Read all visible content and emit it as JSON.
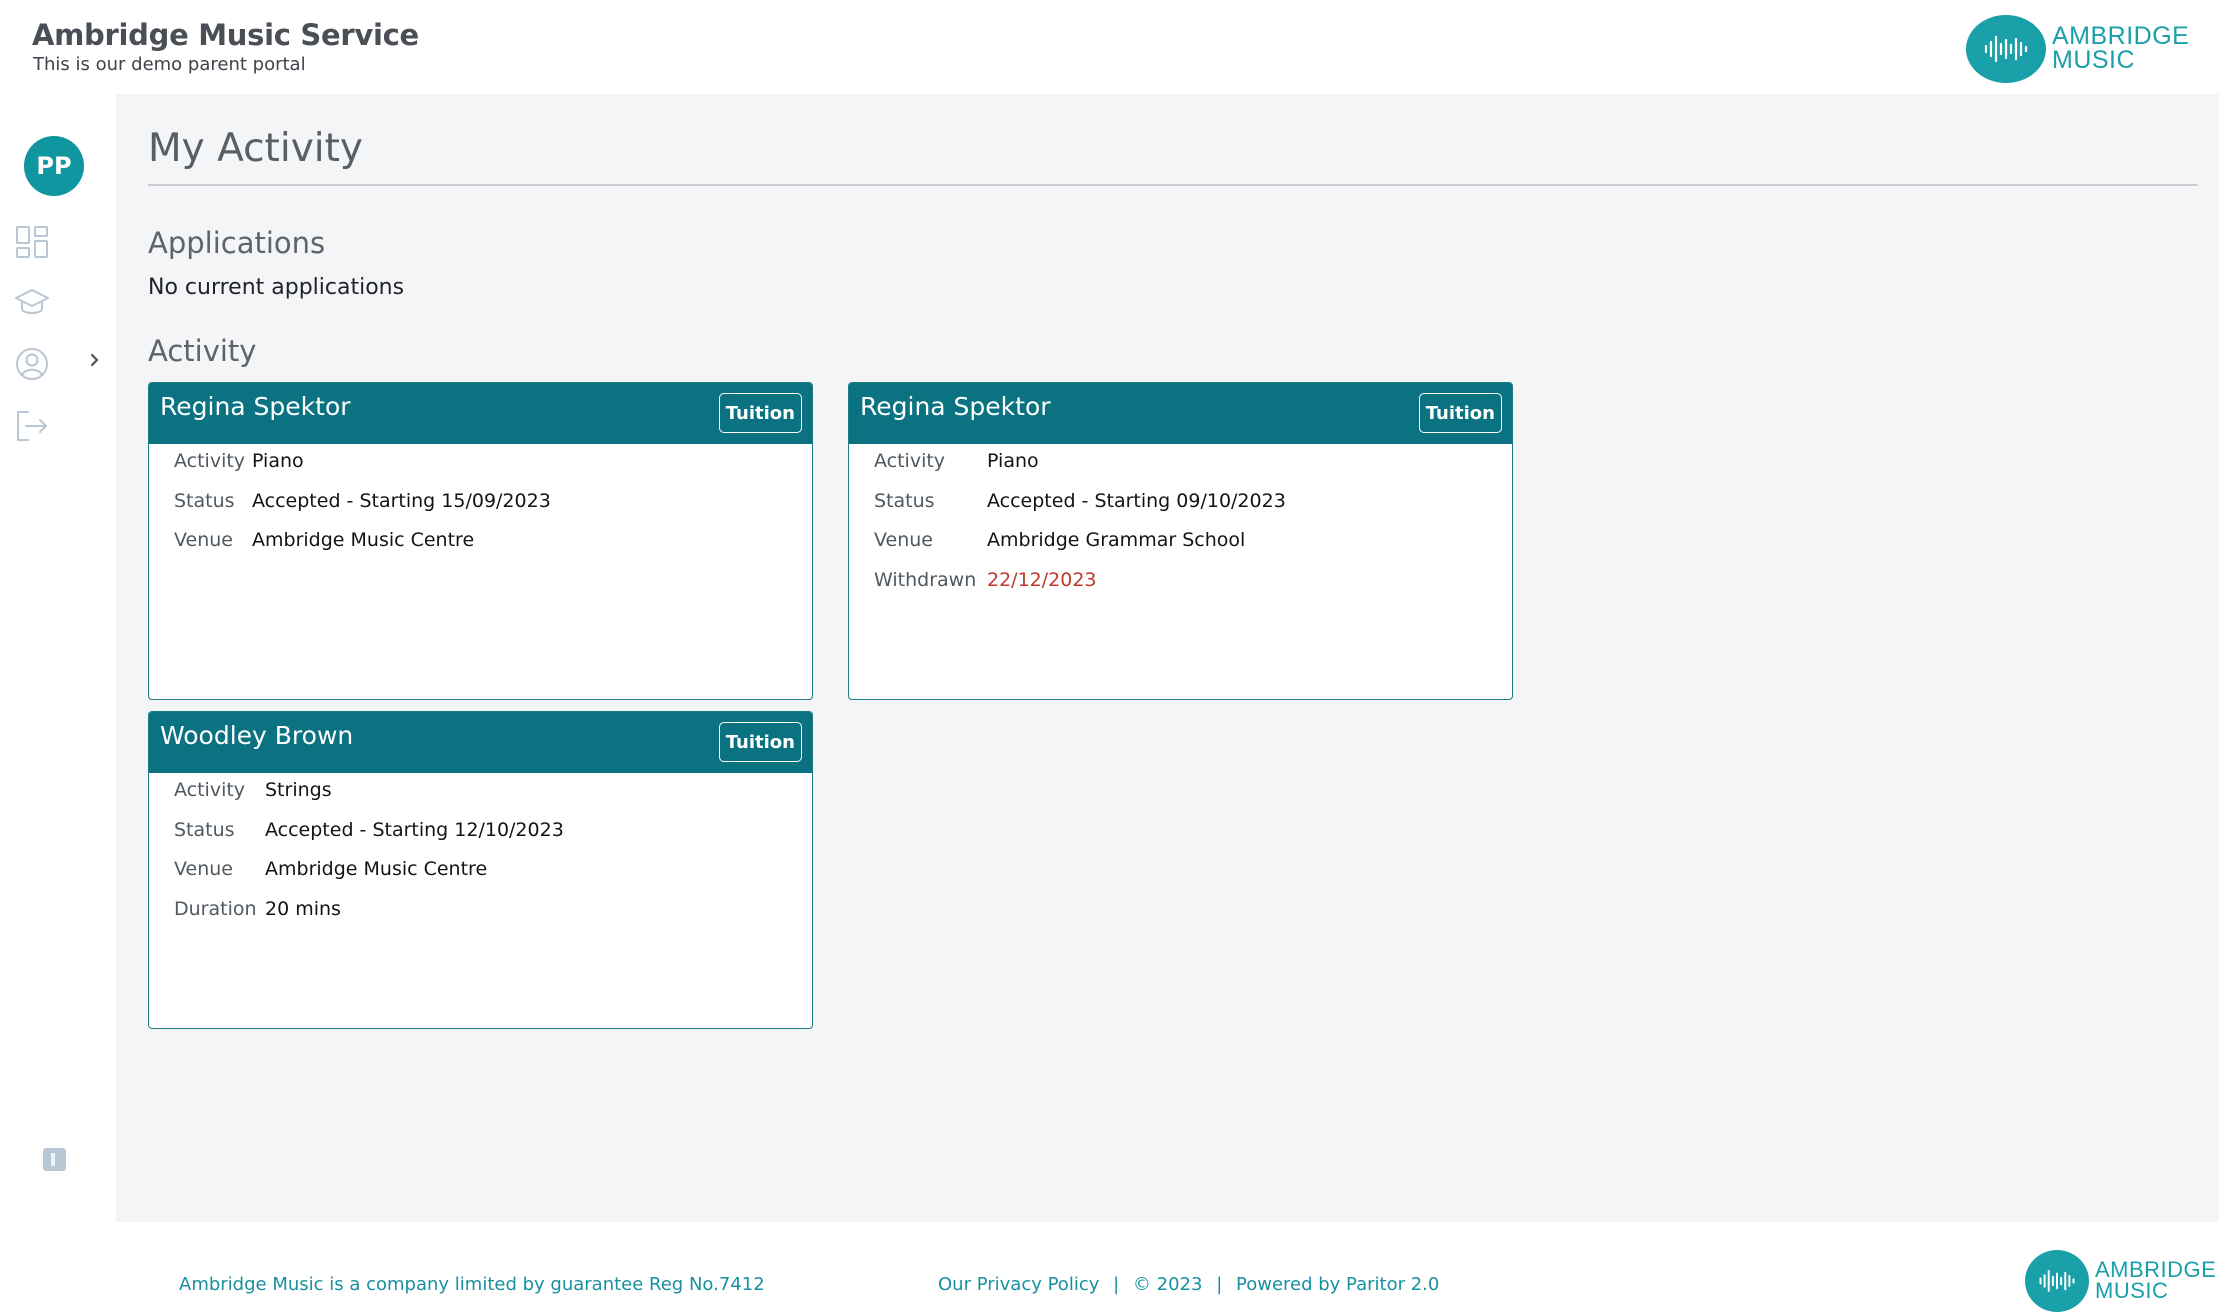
{
  "header": {
    "title": "Ambridge Music Service",
    "subtitle": "This is our demo parent portal",
    "logo_text_1": "AMBRIDGE",
    "logo_text_2": "MUSIC"
  },
  "sidebar": {
    "avatar_initials": "PP",
    "items": [
      {
        "icon": "dashboard-icon"
      },
      {
        "icon": "graduation-cap-icon"
      },
      {
        "icon": "user-profile-icon"
      },
      {
        "icon": "logout-icon"
      }
    ]
  },
  "main": {
    "page_title": "My Activity",
    "applications_title": "Applications",
    "applications_empty": "No current applications",
    "activity_title": "Activity",
    "cards": [
      {
        "name": "Regina Spektor",
        "tag": "Tuition",
        "rows": [
          {
            "label": "Activity",
            "value": "Piano"
          },
          {
            "label": "Status",
            "value": "Accepted - Starting 15/09/2023"
          },
          {
            "label": "Venue",
            "value": "Ambridge Music Centre"
          }
        ]
      },
      {
        "name": "Regina Spektor",
        "tag": "Tuition",
        "rows": [
          {
            "label": "Activity",
            "value": "Piano"
          },
          {
            "label": "Status",
            "value": "Accepted - Starting 09/10/2023"
          },
          {
            "label": "Venue",
            "value": "Ambridge Grammar School"
          },
          {
            "label": "Withdrawn",
            "value": "22/12/2023"
          }
        ]
      },
      {
        "name": "Woodley Brown",
        "tag": "Tuition",
        "rows": [
          {
            "label": "Activity",
            "value": "Strings"
          },
          {
            "label": "Status",
            "value": "Accepted - Starting 12/10/2023"
          },
          {
            "label": "Venue",
            "value": "Ambridge Music Centre"
          },
          {
            "label": "Duration",
            "value": "20 mins"
          }
        ]
      }
    ]
  },
  "footer": {
    "company": "Ambridge Music is a company limited by guarantee Reg No.7412",
    "privacy": "Our Privacy Policy",
    "sep": "|",
    "copyright": "© 2023",
    "powered": "Powered by Paritor 2.0",
    "logo_text_1": "AMBRIDGE",
    "logo_text_2": "MUSIC"
  },
  "colors": {
    "brand_teal": "#0a7280",
    "logo_teal": "#1aa0a8",
    "withdrawn_red": "#c0392b",
    "footer_link": "#1890a0"
  }
}
